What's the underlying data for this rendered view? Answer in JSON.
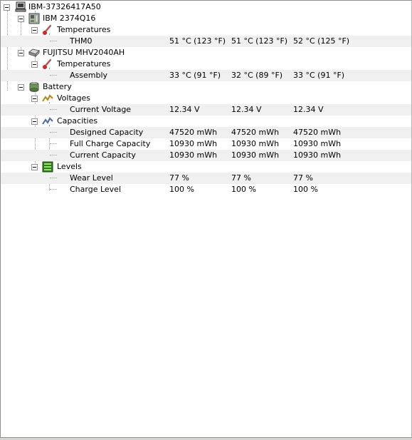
{
  "tree": {
    "root": {
      "label": "IBM-37326417A50"
    },
    "mainboard": {
      "label": "IBM 2374Q16"
    },
    "mb_temps": {
      "label": "Temperatures"
    },
    "thm0": {
      "label": "THM0",
      "values": [
        "51 °C  (123 °F)",
        "51 °C  (123 °F)",
        "52 °C  (125 °F)"
      ]
    },
    "hdd": {
      "label": "FUJITSU MHV2040AH"
    },
    "hdd_temps": {
      "label": "Temperatures"
    },
    "assembly": {
      "label": "Assembly",
      "values": [
        "33 °C  (91 °F)",
        "32 °C  (89 °F)",
        "33 °C  (91 °F)"
      ]
    },
    "battery": {
      "label": "Battery"
    },
    "voltages": {
      "label": "Voltages"
    },
    "current_voltage": {
      "label": "Current Voltage",
      "values": [
        "12.34 V",
        "12.34 V",
        "12.34 V"
      ]
    },
    "capacities": {
      "label": "Capacities"
    },
    "designed_capacity": {
      "label": "Designed Capacity",
      "values": [
        "47520 mWh",
        "47520 mWh",
        "47520 mWh"
      ]
    },
    "full_charge_capacity": {
      "label": "Full Charge Capacity",
      "values": [
        "10930 mWh",
        "10930 mWh",
        "10930 mWh"
      ]
    },
    "current_capacity": {
      "label": "Current Capacity",
      "values": [
        "10930 mWh",
        "10930 mWh",
        "10930 mWh"
      ]
    },
    "levels": {
      "label": "Levels"
    },
    "wear_level": {
      "label": "Wear Level",
      "values": [
        "77 %",
        "77 %",
        "77 %"
      ]
    },
    "charge_level": {
      "label": "Charge Level",
      "values": [
        "100 %",
        "100 %",
        "100 %"
      ]
    }
  },
  "colors": {
    "row_highlight": "#f0f0f0",
    "tree_lines": "#a0a0a0",
    "border": "#8f8f8f"
  }
}
